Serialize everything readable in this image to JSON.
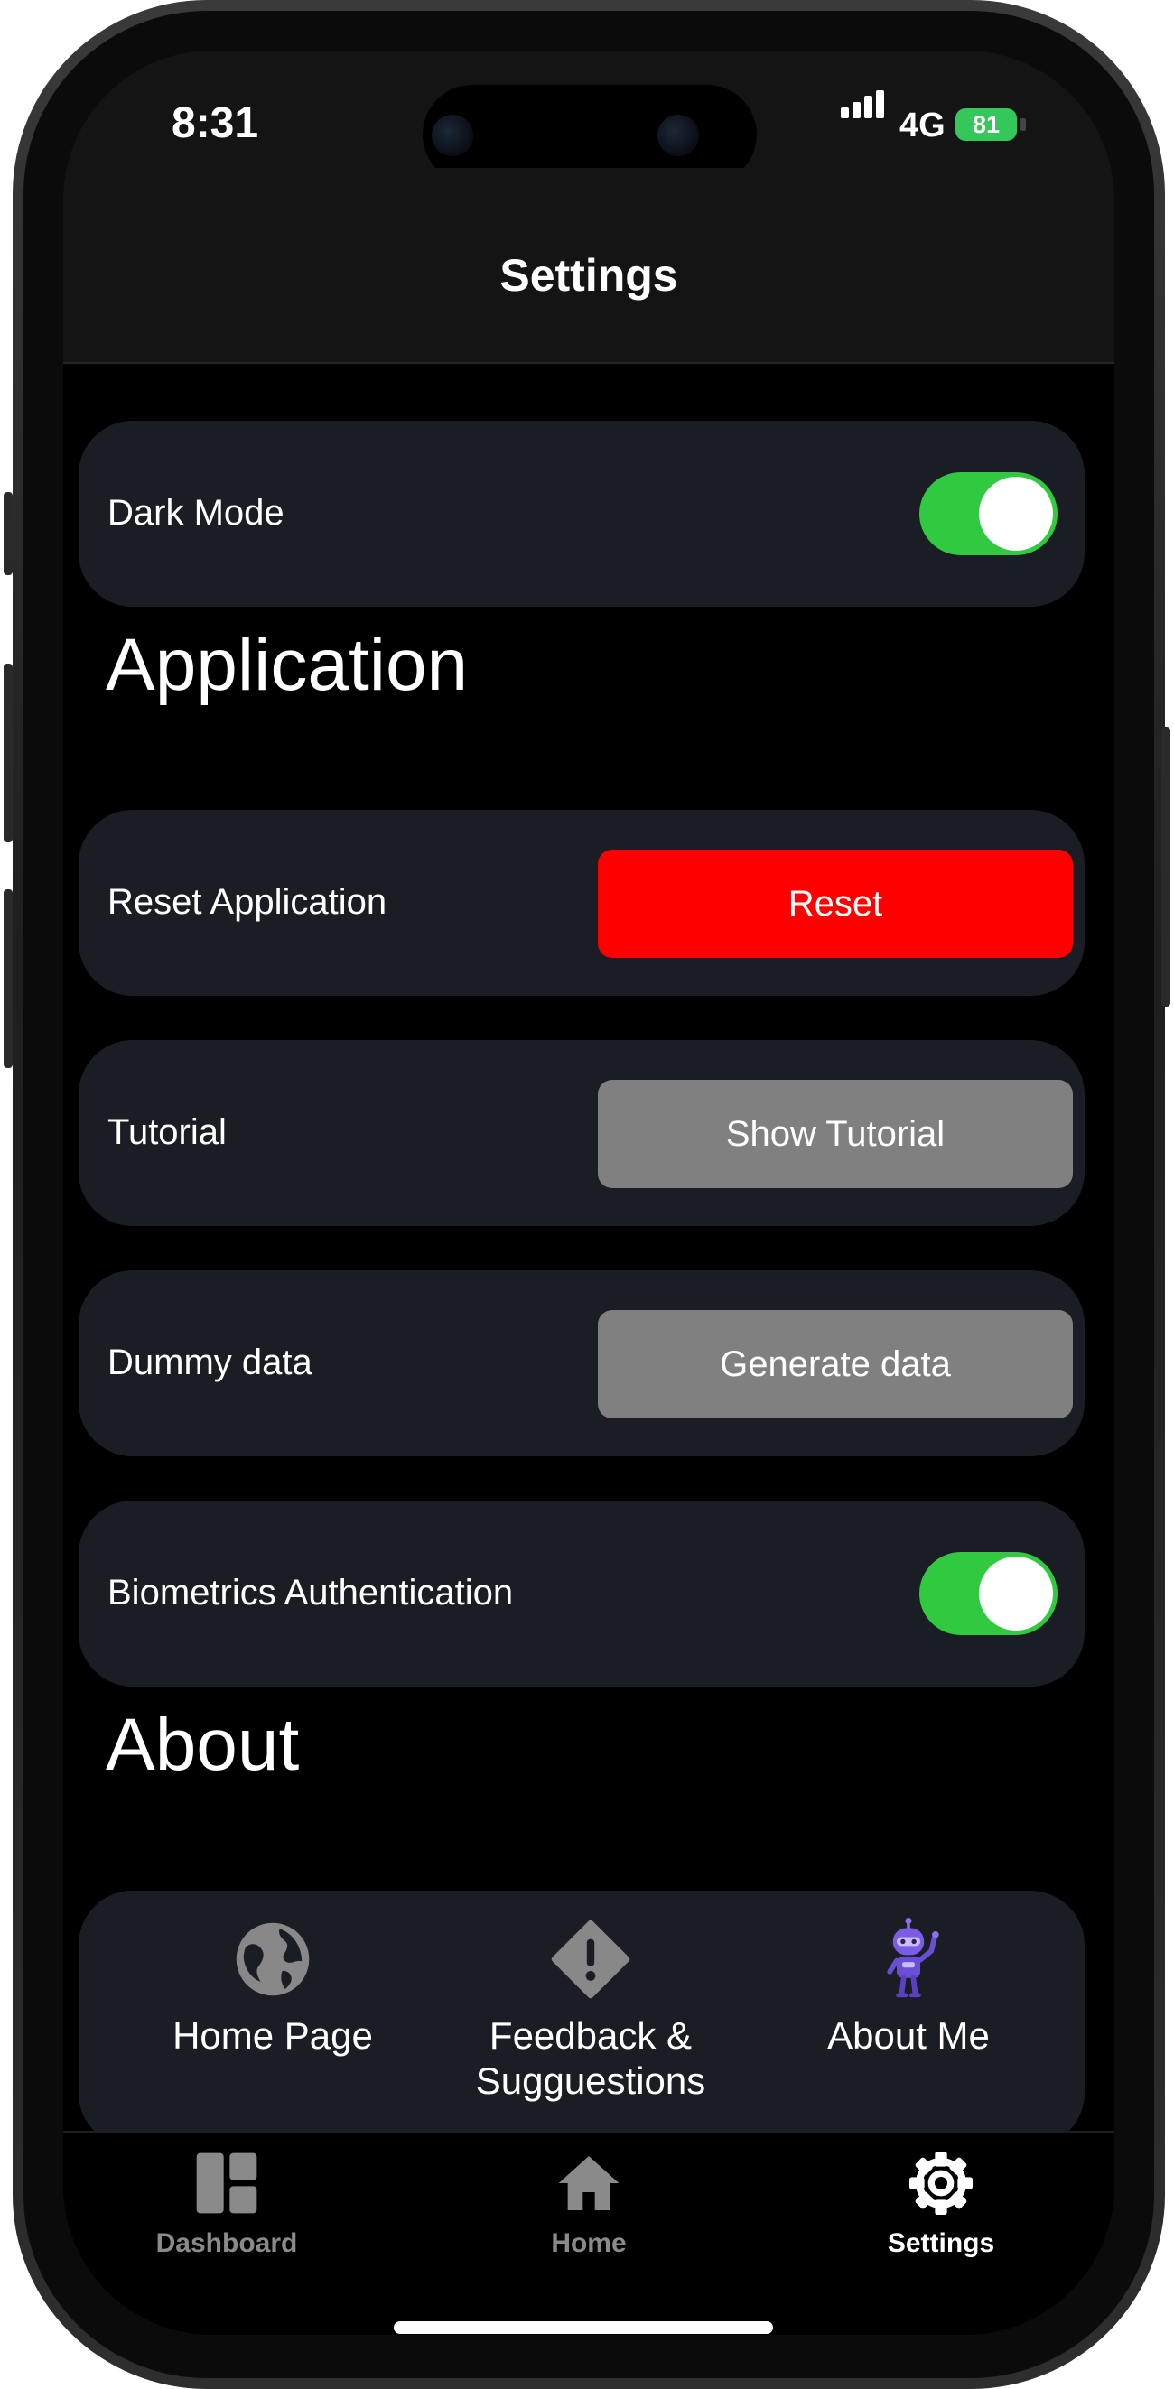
{
  "status_bar": {
    "time": "8:31",
    "network": "4G",
    "battery": "81"
  },
  "header": {
    "title": "Settings"
  },
  "dark_mode": {
    "label": "Dark Mode",
    "enabled": true
  },
  "application_section": {
    "title": "Application",
    "reset": {
      "label": "Reset Application",
      "button": "Reset"
    },
    "tutorial": {
      "label": "Tutorial",
      "button": "Show Tutorial"
    },
    "dummy_data": {
      "label": "Dummy data",
      "button": "Generate data"
    },
    "biometrics": {
      "label": "Biometrics Authentication",
      "enabled": true
    }
  },
  "about_section": {
    "title": "About",
    "items": [
      {
        "label": "Home Page",
        "icon": "globe-icon"
      },
      {
        "label": "Feedback & Sugguestions",
        "icon": "alert-diamond-icon"
      },
      {
        "label": "About Me",
        "icon": "robot-avatar-icon"
      }
    ]
  },
  "tab_bar": {
    "tabs": [
      {
        "label": "Dashboard",
        "icon": "dashboard-icon",
        "active": false
      },
      {
        "label": "Home",
        "icon": "home-icon",
        "active": false
      },
      {
        "label": "Settings",
        "icon": "gear-icon",
        "active": true
      }
    ]
  },
  "colors": {
    "toggle_on": "#30c93f",
    "danger": "#ff0000",
    "neutral_button": "#808080",
    "card": "#1a1e24",
    "battery": "#34c759",
    "accent_purple": "#7b5ce6"
  }
}
